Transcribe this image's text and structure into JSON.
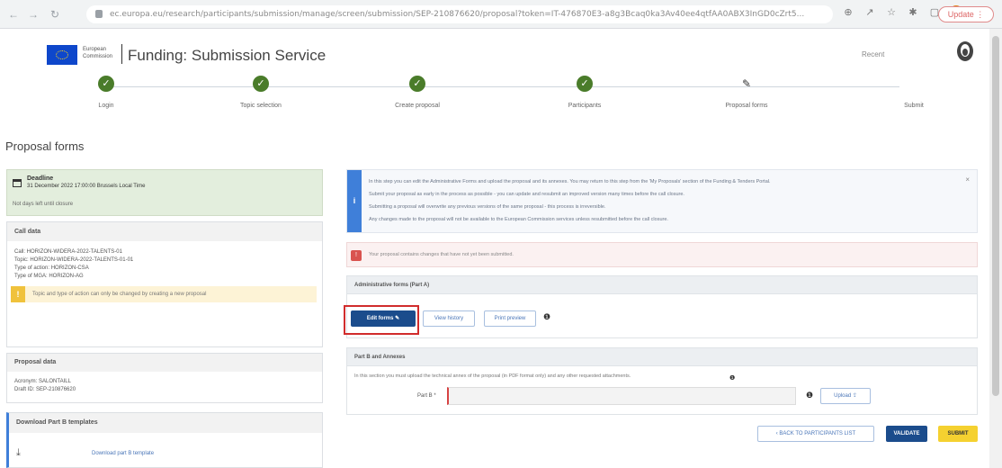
{
  "browser": {
    "url": "ec.europa.eu/research/participants/submission/manage/screen/submission/SEP-210876620/proposal?token=IT-476870E3-a8g3Bcaq0ka3Av40ee4qtfAA0ABX3InGD0cZrt5...",
    "update_label": "Update ⋮"
  },
  "header": {
    "brand_line1": "European",
    "brand_line2": "Commission",
    "title": "Funding: Submission Service",
    "lang": "Recent"
  },
  "steps": [
    {
      "label": "Login",
      "state": "done"
    },
    {
      "label": "Topic selection",
      "state": "done"
    },
    {
      "label": "Create proposal",
      "state": "done"
    },
    {
      "label": "Participants",
      "state": "done"
    },
    {
      "label": "Proposal forms",
      "state": "current"
    },
    {
      "label": "Submit",
      "state": "todo"
    }
  ],
  "page": {
    "title": "Proposal forms"
  },
  "deadline": {
    "title": "Deadline",
    "date": "31 December 2022 17:00:00 Brussels Local Time",
    "days_left": "Not days left until closure"
  },
  "call_data": {
    "heading": "Call data",
    "lines": [
      "Call: HORIZON-WIDERA-2022-TALENTS-01",
      "Topic: HORIZON-WIDERA-2022-TALENTS-01-01",
      "Type of action: HORIZON-CSA",
      "Type of MGA: HORIZON-AG"
    ],
    "warning": "Topic and type of action can only be changed by creating a new proposal"
  },
  "proposal_data": {
    "heading": "Proposal data",
    "lines": [
      "Acronym: SALONTAILL",
      "Draft ID: SEP-210876620"
    ]
  },
  "templates": {
    "heading": "Download Part B templates",
    "link": "Download part B template"
  },
  "info": {
    "lines": [
      "In this step you can edit the Administrative Forms and upload the proposal and its annexes. You may return to this step from the 'My Proposals' section of the Funding & Tenders Portal.",
      "Submit your proposal as early in the process as possible - you can update and resubmit an improved version many times before the call closure.",
      "Submitting a proposal will overwrite any previous versions of the same proposal - this process is irreversible.",
      "Any changes made to the proposal will not be available to the European Commission services unless resubmitted before the call closure."
    ]
  },
  "error": {
    "text": "Your proposal contains changes that have not yet been submitted."
  },
  "admin_forms": {
    "heading": "Administrative forms (Part A)",
    "edit_label": "Edit forms",
    "history_label": "View history",
    "print_label": "Print preview"
  },
  "part_b": {
    "heading": "Part B and Annexes",
    "description": "In this section you must upload the technical annex of the proposal (in PDF format only) and any other requested attachments.",
    "field_label": "Part B *",
    "upload_label": "Upload"
  },
  "footer": {
    "back_label": "BACK TO PARTICIPANTS LIST",
    "validate_label": "VALIDATE",
    "submit_label": "SUBMIT"
  },
  "colors": {
    "step_done": "#4a7c2a",
    "primary": "#1b4c8c",
    "submit": "#f5d130",
    "highlight": "#d12c2c",
    "info": "#3f7fd9"
  }
}
